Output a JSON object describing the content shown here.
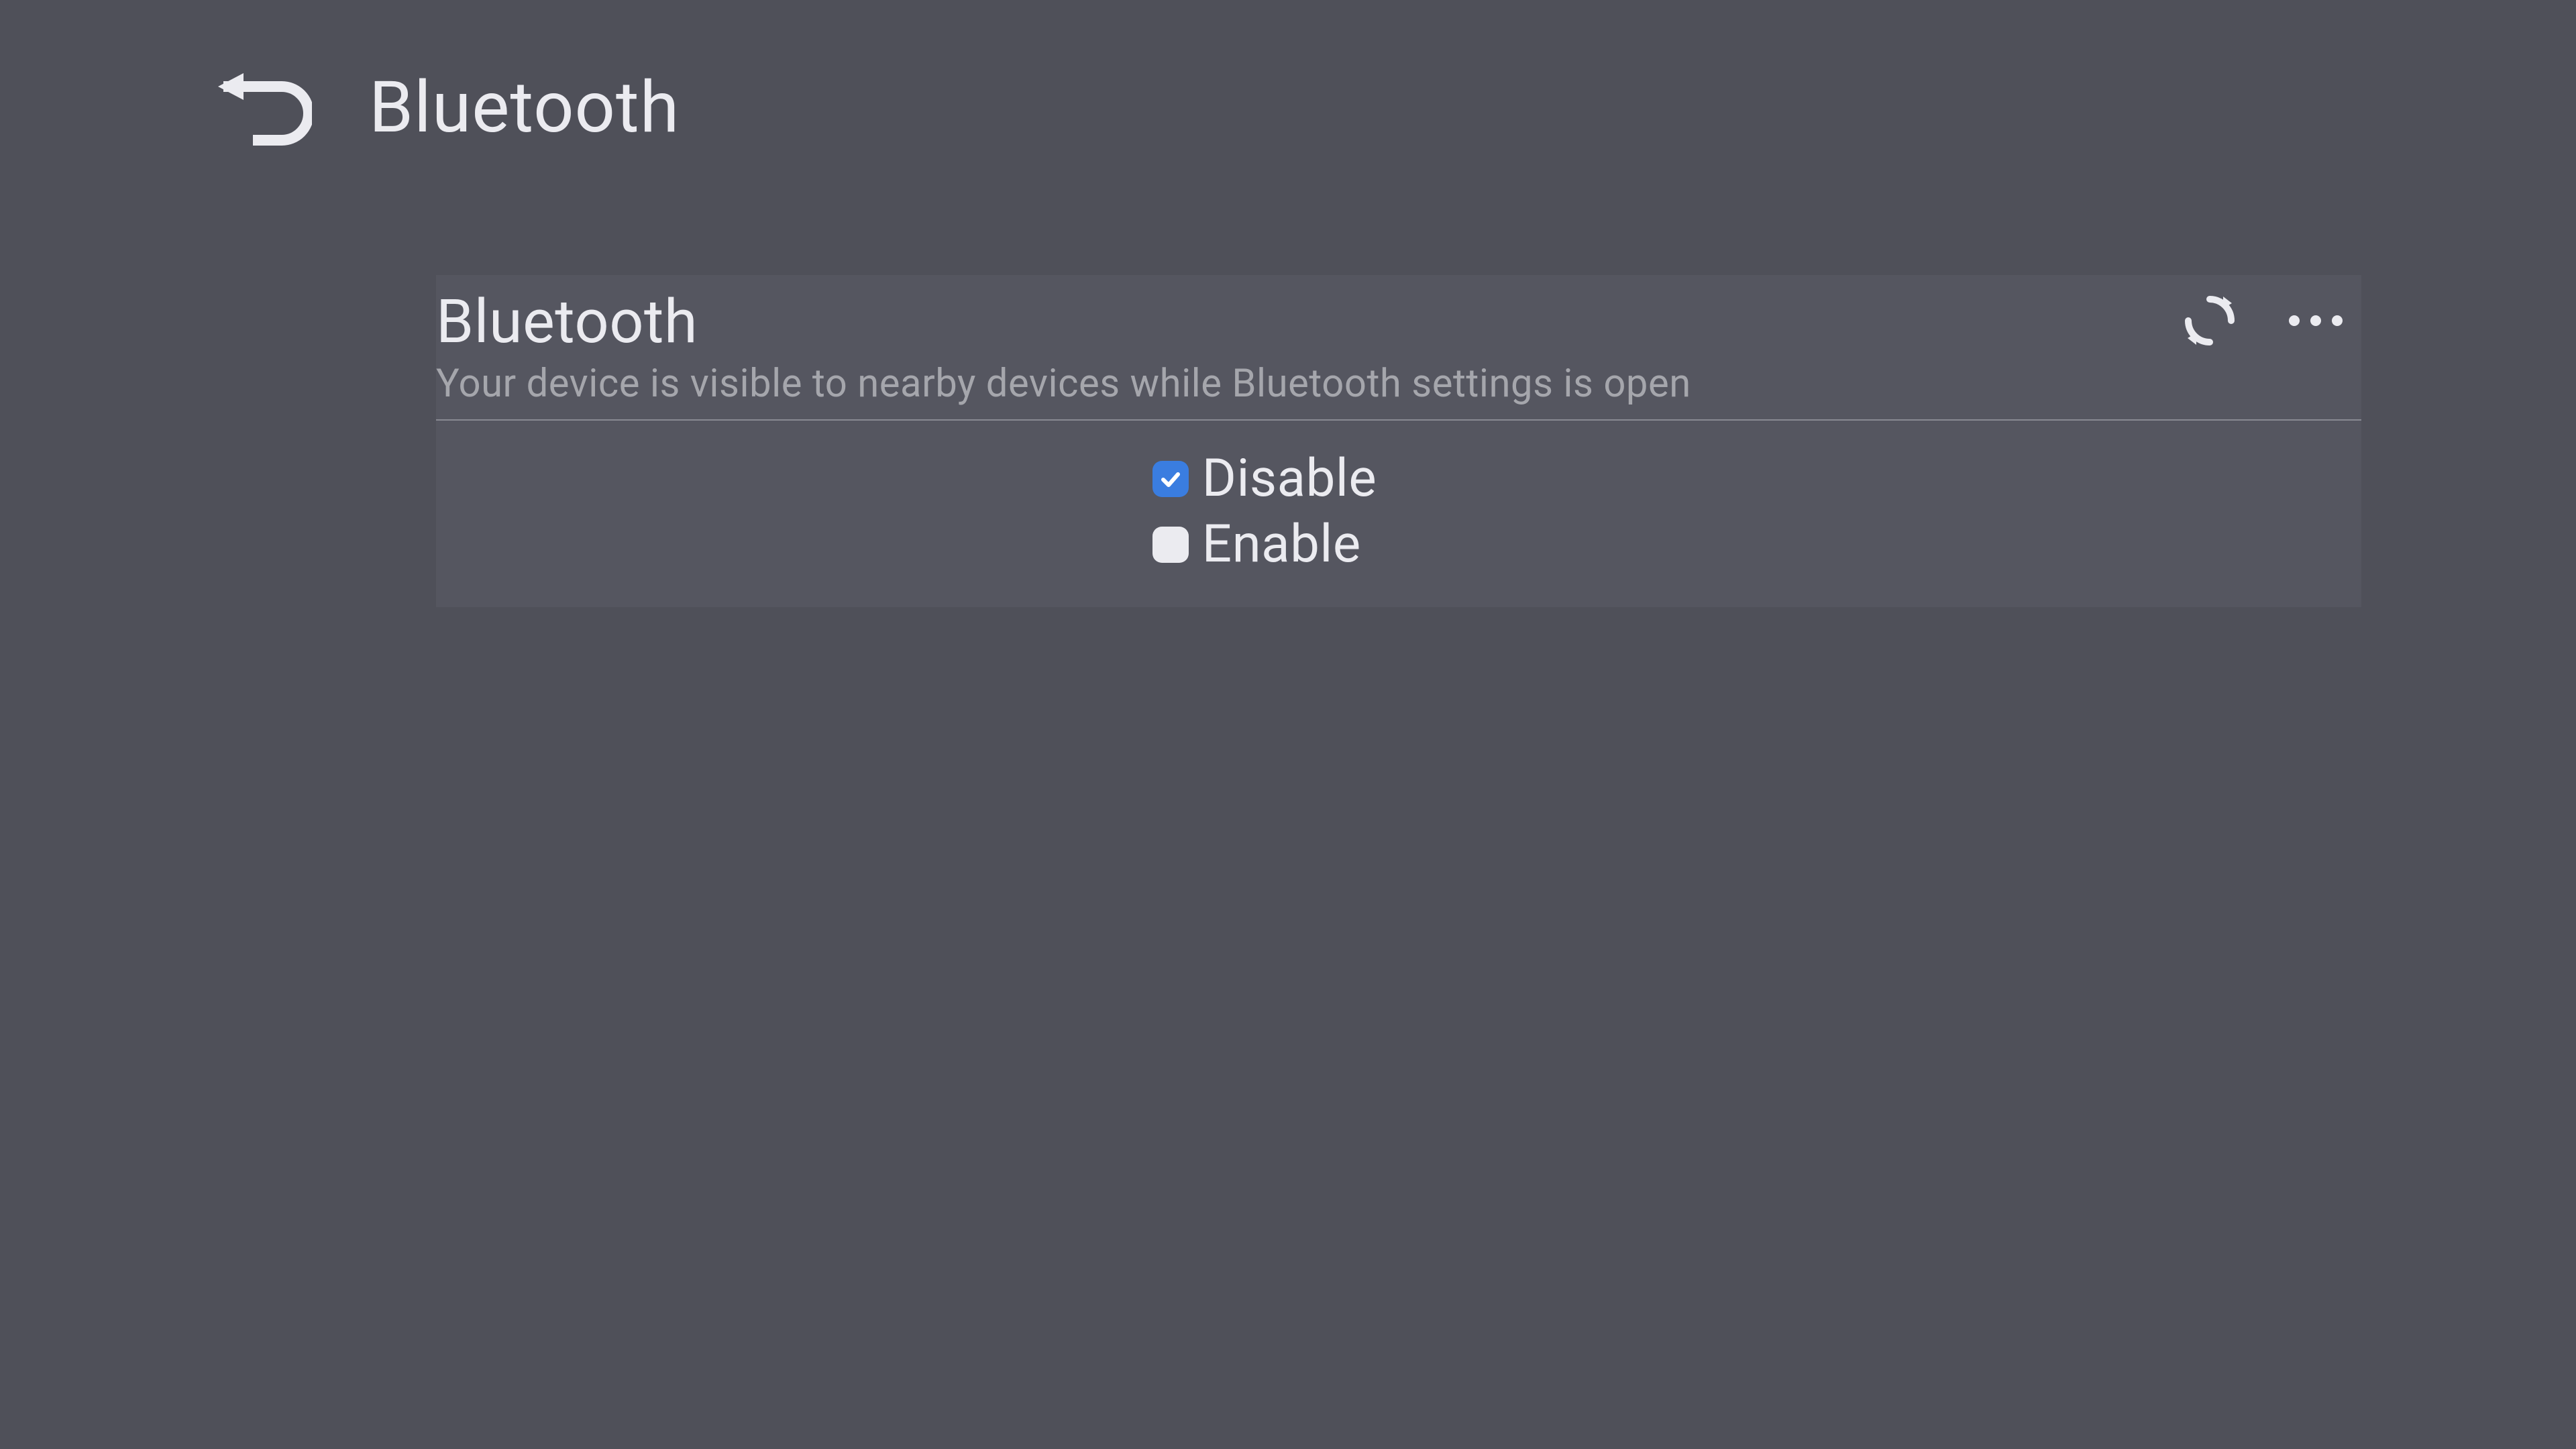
{
  "header": {
    "title": "Bluetooth"
  },
  "panel": {
    "title": "Bluetooth",
    "subtitle": "Your device is visible to nearby devices while Bluetooth settings is open"
  },
  "options": {
    "disable": {
      "label": "Disable",
      "checked": true
    },
    "enable": {
      "label": "Enable",
      "checked": false
    }
  },
  "icons": {
    "back": "back-icon",
    "refresh": "refresh-icon",
    "more": "more-icon"
  },
  "colors": {
    "background": "#4f5059",
    "panel": "#555660",
    "text_primary": "#ebebf0",
    "text_secondary": "#a5a6ac",
    "accent": "#3a7de0"
  }
}
